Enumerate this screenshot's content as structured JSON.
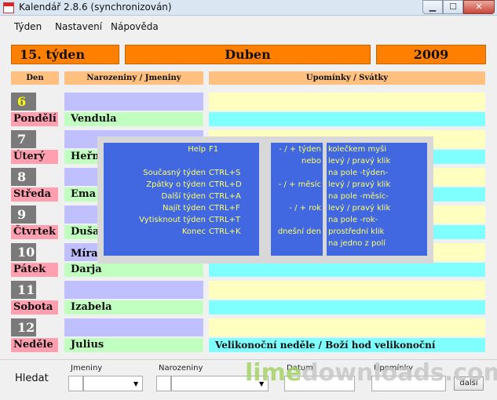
{
  "window": {
    "title": "Kalendář  2.8.6 (synchronizován)",
    "min_glyph": "▁",
    "max_glyph": "☐",
    "close_glyph": "✕"
  },
  "menu": [
    "Týden",
    "Nastavení",
    "Nápověda"
  ],
  "header": {
    "week": "15. týden",
    "month": "Duben",
    "year": "2009"
  },
  "columns": {
    "day": "Den",
    "names": "Narozeniny / Jmeniny",
    "reminders": "Upomínky / Svátky"
  },
  "days": [
    {
      "num": "6",
      "name": "Pondělí",
      "nameday": "Vendula",
      "reminder": "",
      "highlight": true
    },
    {
      "num": "7",
      "name": "Úterý",
      "nameday": "Heřm",
      "reminder": ""
    },
    {
      "num": "8",
      "name": "Středa",
      "nameday": "Ema",
      "reminder": ""
    },
    {
      "num": "9",
      "name": "Čtvrtek",
      "nameday": "Duša",
      "reminder": ""
    },
    {
      "num": "10",
      "name": "Pátek",
      "nameday": "Darja",
      "birthday": "Míra",
      "reminder": ""
    },
    {
      "num": "11",
      "name": "Sobota",
      "nameday": "Izabela",
      "reminder": ""
    },
    {
      "num": "12",
      "name": "Neděle",
      "nameday": "Julius",
      "reminder": "Velikonoční neděle / Boží hod velikonoční"
    }
  ],
  "help": {
    "actions": [
      "Help",
      "",
      "Současný týden",
      "Zpátky o týden",
      "Další týden",
      "Najít týden",
      "Vytisknout týden",
      "Konec"
    ],
    "keys": [
      "F1",
      "",
      "CTRL+S",
      "CTRL+D",
      "CTRL+A",
      "CTRL+F",
      "CTRL+T",
      "CTRL+K"
    ],
    "mouse_actions": [
      "- / + týden",
      "nebo",
      "",
      "- / + měsíc",
      "",
      "- / + rok",
      "",
      "dnešní den"
    ],
    "mouse_gestures": [
      "kolečkem myši",
      "levý / pravý klik",
      "na pole -týden-",
      "levý / pravý klik",
      "na pole -měsíc-",
      "levý / pravý klik",
      "na pole -rok-",
      "prostřední klik",
      "na jedno z polí"
    ]
  },
  "footer": {
    "search_label": "Hledat",
    "names_label": "Jmeniny",
    "birthdays_label": "Narozeniny",
    "date_label": "Datum",
    "reminders_label": "Upomínky",
    "next_button": "další",
    "watermark_green": "lime",
    "watermark_gray": "downloads.com"
  },
  "colors": {
    "orange": "#ff8000",
    "header": "#ffc080",
    "day_pink": "#ff9fb0",
    "names_top": "#c0c0ff",
    "names_bottom": "#c0ffc0",
    "reminder_top": "#ffffc0",
    "reminder_bottom": "#80ffff",
    "help_blue": "#4168e0",
    "help_text": "#ffff66"
  }
}
